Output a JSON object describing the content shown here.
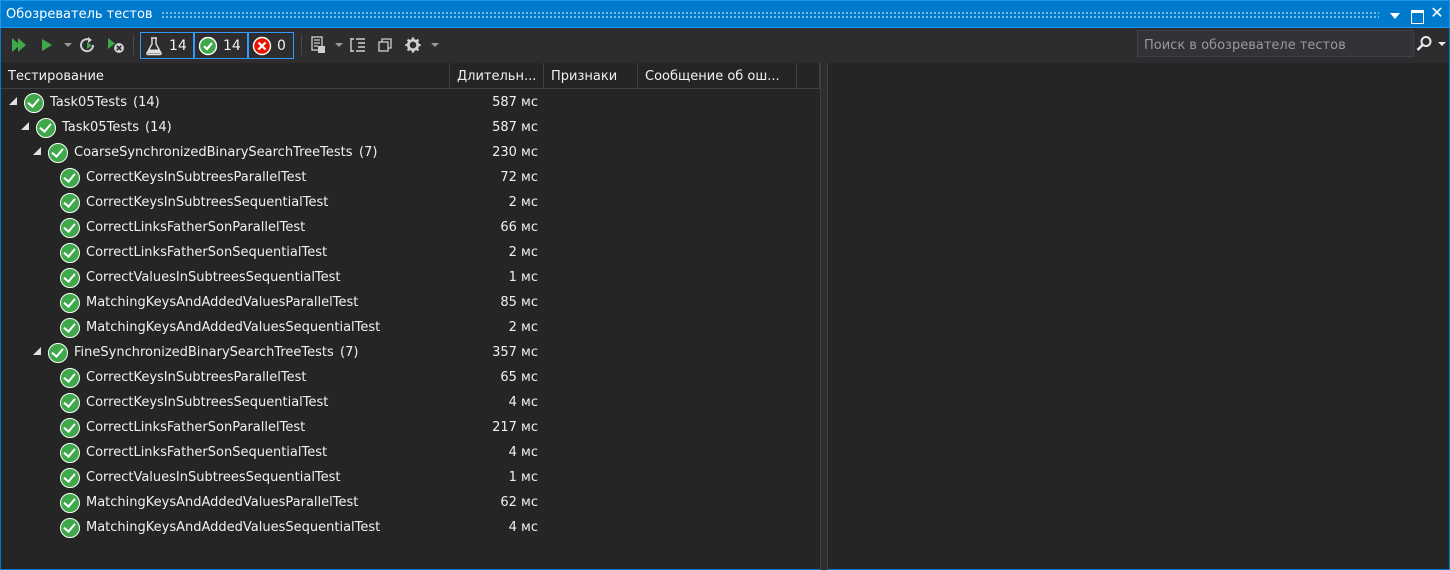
{
  "window": {
    "title": "Обозреватель тестов"
  },
  "toolbar": {
    "total_count": "14",
    "passed_count": "14",
    "failed_count": "0",
    "search_placeholder": "Поиск в обозревателе тестов"
  },
  "columns": {
    "test": "Тестирование",
    "duration": "Длительн...",
    "traits": "Признаки",
    "message": "Сообщение об ош..."
  },
  "colors": {
    "accent": "#007acc",
    "pass": "#3ea84a",
    "fail": "#e51400"
  },
  "rows": [
    {
      "name": "Task05Tests",
      "count": "(14)",
      "duration": "587 мс",
      "level": 0,
      "expanded": true
    },
    {
      "name": "Task05Tests",
      "count": "(14)",
      "duration": "587 мс",
      "level": 1,
      "expanded": true
    },
    {
      "name": "CoarseSynchronizedBinarySearchTreeTests",
      "count": "(7)",
      "duration": "230 мс",
      "level": 2,
      "expanded": true
    },
    {
      "name": "CorrectKeysInSubtreesParallelTest",
      "count": "",
      "duration": "72 мс",
      "level": 3
    },
    {
      "name": "CorrectKeysInSubtreesSequentialTest",
      "count": "",
      "duration": "2 мс",
      "level": 3
    },
    {
      "name": "CorrectLinksFatherSonParallelTest",
      "count": "",
      "duration": "66 мс",
      "level": 3
    },
    {
      "name": "CorrectLinksFatherSonSequentialTest",
      "count": "",
      "duration": "2 мс",
      "level": 3
    },
    {
      "name": "CorrectValuesInSubtreesSequentialTest",
      "count": "",
      "duration": "1 мс",
      "level": 3
    },
    {
      "name": "MatchingKeysAndAddedValuesParallelTest",
      "count": "",
      "duration": "85 мс",
      "level": 3
    },
    {
      "name": "MatchingKeysAndAddedValuesSequentialTest",
      "count": "",
      "duration": "2 мс",
      "level": 3
    },
    {
      "name": "FineSynchronizedBinarySearchTreeTests",
      "count": "(7)",
      "duration": "357 мс",
      "level": 2,
      "expanded": true
    },
    {
      "name": "CorrectKeysInSubtreesParallelTest",
      "count": "",
      "duration": "65 мс",
      "level": 3
    },
    {
      "name": "CorrectKeysInSubtreesSequentialTest",
      "count": "",
      "duration": "4 мс",
      "level": 3
    },
    {
      "name": "CorrectLinksFatherSonParallelTest",
      "count": "",
      "duration": "217 мс",
      "level": 3
    },
    {
      "name": "CorrectLinksFatherSonSequentialTest",
      "count": "",
      "duration": "4 мс",
      "level": 3
    },
    {
      "name": "CorrectValuesInSubtreesSequentialTest",
      "count": "",
      "duration": "1 мс",
      "level": 3
    },
    {
      "name": "MatchingKeysAndAddedValuesParallelTest",
      "count": "",
      "duration": "62 мс",
      "level": 3
    },
    {
      "name": "MatchingKeysAndAddedValuesSequentialTest",
      "count": "",
      "duration": "4 мс",
      "level": 3
    }
  ]
}
